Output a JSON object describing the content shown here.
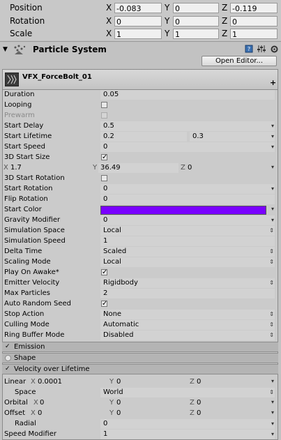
{
  "transform": {
    "rows": [
      {
        "label": "Position",
        "x": "-0.083",
        "y": "0",
        "z": "-0.119"
      },
      {
        "label": "Rotation",
        "x": "0",
        "y": "0",
        "z": "0"
      },
      {
        "label": "Scale",
        "x": "1",
        "y": "1",
        "z": "1"
      }
    ],
    "axes": {
      "x": "X",
      "y": "Y",
      "z": "Z"
    }
  },
  "component": {
    "title": "Particle System",
    "open_editor": "Open Editor...",
    "add_symbol": "+"
  },
  "system": {
    "name": "VFX_ForceBolt_01",
    "main": {
      "duration": {
        "label": "Duration",
        "value": "0.05"
      },
      "looping": {
        "label": "Looping"
      },
      "prewarm": {
        "label": "Prewarm"
      },
      "start_delay": {
        "label": "Start Delay",
        "value": "0.5"
      },
      "start_lifetime": {
        "label": "Start Lifetime",
        "min": "0.2",
        "max": "0.3"
      },
      "start_speed": {
        "label": "Start Speed",
        "value": "0"
      },
      "start_size_3d": {
        "label": "3D Start Size",
        "checked": "✓"
      },
      "size_xyz": {
        "x": "1.7",
        "y": "36.49",
        "z": "0"
      },
      "start_rotation_3d": {
        "label": "3D Start Rotation"
      },
      "start_rotation": {
        "label": "Start Rotation",
        "value": "0"
      },
      "flip_rotation": {
        "label": "Flip Rotation",
        "value": "0"
      },
      "start_color": {
        "label": "Start Color",
        "color": "#7a00ff"
      },
      "gravity_modifier": {
        "label": "Gravity Modifier",
        "value": "0"
      },
      "simulation_space": {
        "label": "Simulation Space",
        "value": "Local"
      },
      "simulation_speed": {
        "label": "Simulation Speed",
        "value": "1"
      },
      "delta_time": {
        "label": "Delta Time",
        "value": "Scaled"
      },
      "scaling_mode": {
        "label": "Scaling Mode",
        "value": "Local"
      },
      "play_on_awake": {
        "label": "Play On Awake*",
        "checked": "✓"
      },
      "emitter_velocity": {
        "label": "Emitter Velocity",
        "value": "Rigidbody"
      },
      "max_particles": {
        "label": "Max Particles",
        "value": "2"
      },
      "auto_random_seed": {
        "label": "Auto Random Seed",
        "checked": "✓"
      },
      "stop_action": {
        "label": "Stop Action",
        "value": "None"
      },
      "culling_mode": {
        "label": "Culling Mode",
        "value": "Automatic"
      },
      "ring_buffer_mode": {
        "label": "Ring Buffer Mode",
        "value": "Disabled"
      }
    },
    "modules": {
      "emission": {
        "label": "Emission",
        "checked": "✓"
      },
      "shape": {
        "label": "Shape"
      },
      "velocity_over_lifetime": {
        "label": "Velocity over Lifetime",
        "checked": "✓"
      }
    },
    "velocity": {
      "linear": {
        "label": "Linear",
        "x": "0.0001",
        "y": "0",
        "z": "0"
      },
      "space": {
        "label": "Space",
        "value": "World"
      },
      "orbital": {
        "label": "Orbital",
        "x": "0",
        "y": "0",
        "z": "0"
      },
      "offset": {
        "label": "Offset",
        "x": "0",
        "y": "0",
        "z": "0"
      },
      "radial": {
        "label": "Radial",
        "value": "0"
      },
      "speed_modifier": {
        "label": "Speed Modifier",
        "value": "1"
      }
    }
  },
  "colors": {
    "start_color": "#7a00ff"
  }
}
